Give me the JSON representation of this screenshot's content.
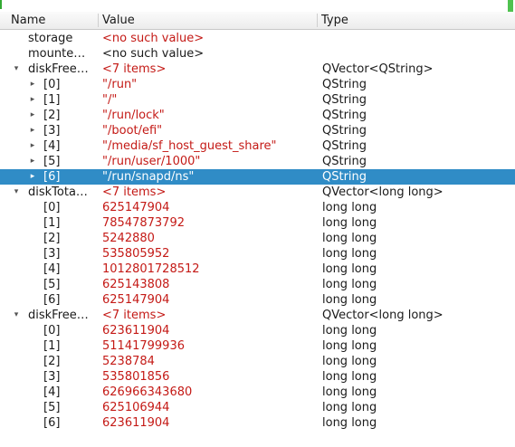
{
  "header": {
    "name": "Name",
    "value": "Value",
    "type": "Type"
  },
  "rows": [
    {
      "name": "storage",
      "value": "<no such value>",
      "type": "",
      "depth": 0,
      "expand": "none",
      "valueStyle": "red"
    },
    {
      "name": "mounte…",
      "value": "<no such value>",
      "type": "",
      "depth": 0,
      "expand": "none",
      "valueStyle": "plain"
    },
    {
      "name": "diskFree…",
      "value": "<7 items>",
      "type": "QVector<QString>",
      "depth": 0,
      "expand": "expanded",
      "valueStyle": "red"
    },
    {
      "name": "[0]",
      "value": "\"/run\"",
      "type": "QString",
      "depth": 1,
      "expand": "collapsed",
      "valueStyle": "red"
    },
    {
      "name": "[1]",
      "value": "\"/\"",
      "type": "QString",
      "depth": 1,
      "expand": "collapsed",
      "valueStyle": "red"
    },
    {
      "name": "[2]",
      "value": "\"/run/lock\"",
      "type": "QString",
      "depth": 1,
      "expand": "collapsed",
      "valueStyle": "red"
    },
    {
      "name": "[3]",
      "value": "\"/boot/efi\"",
      "type": "QString",
      "depth": 1,
      "expand": "collapsed",
      "valueStyle": "red"
    },
    {
      "name": "[4]",
      "value": "\"/media/sf_host_guest_share\"",
      "type": "QString",
      "depth": 1,
      "expand": "collapsed",
      "valueStyle": "red"
    },
    {
      "name": "[5]",
      "value": "\"/run/user/1000\"",
      "type": "QString",
      "depth": 1,
      "expand": "collapsed",
      "valueStyle": "red"
    },
    {
      "name": "[6]",
      "value": "\"/run/snapd/ns\"",
      "type": "QString",
      "depth": 1,
      "expand": "collapsed",
      "valueStyle": "red",
      "selected": true
    },
    {
      "name": "diskTota…",
      "value": "<7 items>",
      "type": "QVector<long long>",
      "depth": 0,
      "expand": "expanded",
      "valueStyle": "red"
    },
    {
      "name": "[0]",
      "value": "625147904",
      "type": "long long",
      "depth": 1,
      "expand": "none",
      "valueStyle": "red"
    },
    {
      "name": "[1]",
      "value": "78547873792",
      "type": "long long",
      "depth": 1,
      "expand": "none",
      "valueStyle": "red"
    },
    {
      "name": "[2]",
      "value": "5242880",
      "type": "long long",
      "depth": 1,
      "expand": "none",
      "valueStyle": "red"
    },
    {
      "name": "[3]",
      "value": "535805952",
      "type": "long long",
      "depth": 1,
      "expand": "none",
      "valueStyle": "red"
    },
    {
      "name": "[4]",
      "value": "1012801728512",
      "type": "long long",
      "depth": 1,
      "expand": "none",
      "valueStyle": "red"
    },
    {
      "name": "[5]",
      "value": "625143808",
      "type": "long long",
      "depth": 1,
      "expand": "none",
      "valueStyle": "red"
    },
    {
      "name": "[6]",
      "value": "625147904",
      "type": "long long",
      "depth": 1,
      "expand": "none",
      "valueStyle": "red"
    },
    {
      "name": "diskFree…",
      "value": "<7 items>",
      "type": "QVector<long long>",
      "depth": 0,
      "expand": "expanded",
      "valueStyle": "red"
    },
    {
      "name": "[0]",
      "value": "623611904",
      "type": "long long",
      "depth": 1,
      "expand": "none",
      "valueStyle": "red"
    },
    {
      "name": "[1]",
      "value": "51141799936",
      "type": "long long",
      "depth": 1,
      "expand": "none",
      "valueStyle": "red"
    },
    {
      "name": "[2]",
      "value": "5238784",
      "type": "long long",
      "depth": 1,
      "expand": "none",
      "valueStyle": "red"
    },
    {
      "name": "[3]",
      "value": "535801856",
      "type": "long long",
      "depth": 1,
      "expand": "none",
      "valueStyle": "red"
    },
    {
      "name": "[4]",
      "value": "626966343680",
      "type": "long long",
      "depth": 1,
      "expand": "none",
      "valueStyle": "red"
    },
    {
      "name": "[5]",
      "value": "625106944",
      "type": "long long",
      "depth": 1,
      "expand": "none",
      "valueStyle": "red"
    },
    {
      "name": "[6]",
      "value": "623611904",
      "type": "long long",
      "depth": 1,
      "expand": "none",
      "valueStyle": "red"
    }
  ],
  "colors": {
    "selection": "#308cc6",
    "value_text": "#c41a16"
  },
  "icons": {
    "expanded": "triangle-down-icon",
    "collapsed": "triangle-right-icon"
  }
}
